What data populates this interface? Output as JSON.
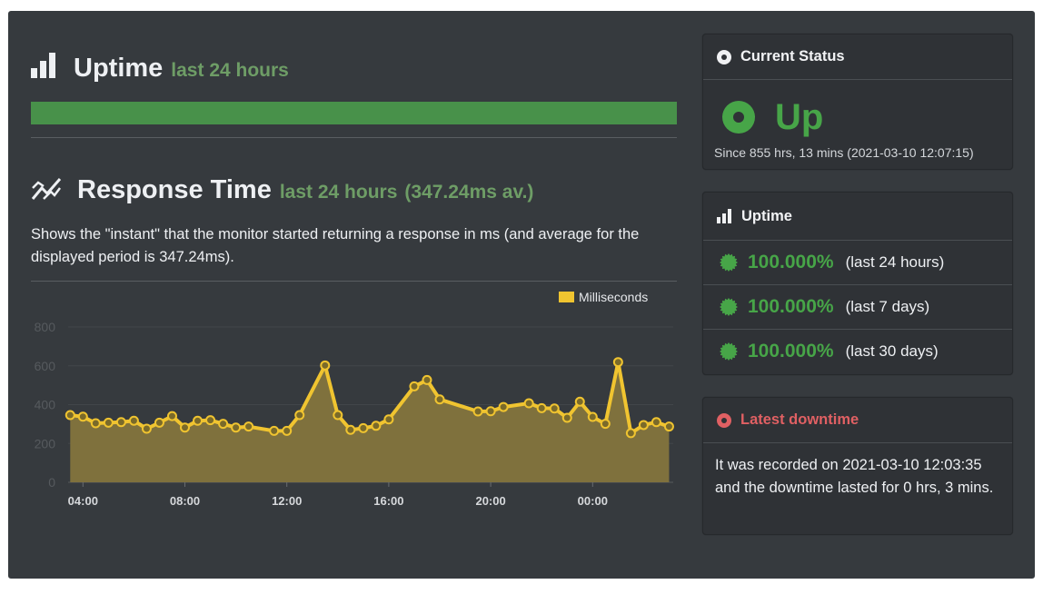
{
  "uptime_section": {
    "title": "Uptime",
    "subtitle": "last 24 hours",
    "bar_percent": 100,
    "bar_color": "#48914a"
  },
  "response_section": {
    "title": "Response Time",
    "subtitle": "last 24 hours",
    "average": "(347.24ms av.)",
    "description": "Shows the \"instant\" that the monitor started returning a response in ms (and average for the displayed period is 347.24ms)."
  },
  "chart_data": {
    "type": "area",
    "title": "",
    "xlabel": "",
    "ylabel": "",
    "legend": {
      "label": "Milliseconds",
      "position": "top-right",
      "color": "#f0c430"
    },
    "ylim": [
      0,
      800
    ],
    "yticks": [
      0,
      200,
      400,
      600,
      800
    ],
    "grid": true,
    "xticks": [
      {
        "label": "04:00",
        "hour": 4
      },
      {
        "label": "08:00",
        "hour": 8
      },
      {
        "label": "12:00",
        "hour": 12
      },
      {
        "label": "16:00",
        "hour": 16
      },
      {
        "label": "20:00",
        "hour": 20
      },
      {
        "label": "00:00",
        "hour": 24
      }
    ],
    "x_hour_range": [
      3.5,
      27
    ],
    "series": [
      {
        "name": "Milliseconds",
        "color": "#f0c430",
        "fill": "#7f713d",
        "points": [
          {
            "t": "03:30",
            "hour": 3.5,
            "ms": 346
          },
          {
            "t": "04:00",
            "hour": 4.0,
            "ms": 338
          },
          {
            "t": "04:30",
            "hour": 4.5,
            "ms": 304
          },
          {
            "t": "05:00",
            "hour": 5.0,
            "ms": 307
          },
          {
            "t": "05:30",
            "hour": 5.5,
            "ms": 310
          },
          {
            "t": "06:00",
            "hour": 6.0,
            "ms": 317
          },
          {
            "t": "06:30",
            "hour": 6.5,
            "ms": 276
          },
          {
            "t": "07:00",
            "hour": 7.0,
            "ms": 307
          },
          {
            "t": "07:30",
            "hour": 7.5,
            "ms": 341
          },
          {
            "t": "08:00",
            "hour": 8.0,
            "ms": 282
          },
          {
            "t": "08:30",
            "hour": 8.5,
            "ms": 317
          },
          {
            "t": "09:00",
            "hour": 9.0,
            "ms": 320
          },
          {
            "t": "09:30",
            "hour": 9.5,
            "ms": 301
          },
          {
            "t": "10:00",
            "hour": 10.0,
            "ms": 282
          },
          {
            "t": "10:30",
            "hour": 10.5,
            "ms": 287
          },
          {
            "t": "11:30",
            "hour": 11.5,
            "ms": 265
          },
          {
            "t": "12:00",
            "hour": 12.0,
            "ms": 265
          },
          {
            "t": "12:30",
            "hour": 12.5,
            "ms": 346
          },
          {
            "t": "13:30",
            "hour": 13.5,
            "ms": 602
          },
          {
            "t": "14:00",
            "hour": 14.0,
            "ms": 346
          },
          {
            "t": "14:30",
            "hour": 14.5,
            "ms": 270
          },
          {
            "t": "15:00",
            "hour": 15.0,
            "ms": 279
          },
          {
            "t": "15:30",
            "hour": 15.5,
            "ms": 291
          },
          {
            "t": "16:00",
            "hour": 16.0,
            "ms": 324
          },
          {
            "t": "17:00",
            "hour": 17.0,
            "ms": 494
          },
          {
            "t": "17:30",
            "hour": 17.5,
            "ms": 527
          },
          {
            "t": "18:00",
            "hour": 18.0,
            "ms": 427
          },
          {
            "t": "19:30",
            "hour": 19.5,
            "ms": 365
          },
          {
            "t": "20:00",
            "hour": 20.0,
            "ms": 366
          },
          {
            "t": "20:30",
            "hour": 20.5,
            "ms": 388
          },
          {
            "t": "21:30",
            "hour": 21.5,
            "ms": 407
          },
          {
            "t": "22:00",
            "hour": 22.0,
            "ms": 382
          },
          {
            "t": "22:30",
            "hour": 22.5,
            "ms": 380
          },
          {
            "t": "23:00",
            "hour": 23.0,
            "ms": 332
          },
          {
            "t": "23:30",
            "hour": 23.5,
            "ms": 415
          },
          {
            "t": "00:00",
            "hour": 24.0,
            "ms": 337
          },
          {
            "t": "00:30",
            "hour": 24.5,
            "ms": 301
          },
          {
            "t": "01:00",
            "hour": 25.0,
            "ms": 619
          },
          {
            "t": "01:30",
            "hour": 25.5,
            "ms": 253
          },
          {
            "t": "02:00",
            "hour": 26.0,
            "ms": 295
          },
          {
            "t": "02:30",
            "hour": 26.5,
            "ms": 310
          },
          {
            "t": "03:00",
            "hour": 27.0,
            "ms": 287
          }
        ]
      }
    ]
  },
  "current_status": {
    "title": "Current Status",
    "status": "Up",
    "status_color": "#47a548",
    "since": "Since 855 hrs, 13 mins (2021-03-10 12:07:15)"
  },
  "uptime_card": {
    "title": "Uptime",
    "items": [
      {
        "percent": "100.000%",
        "period": "(last 24 hours)"
      },
      {
        "percent": "100.000%",
        "period": "(last 7 days)"
      },
      {
        "percent": "100.000%",
        "period": "(last 30 days)"
      }
    ]
  },
  "latest_downtime": {
    "title": "Latest downtime",
    "title_color": "#e06063",
    "text": "It was recorded on 2021-03-10 12:03:35 and the downtime lasted for 0 hrs, 3 mins."
  }
}
